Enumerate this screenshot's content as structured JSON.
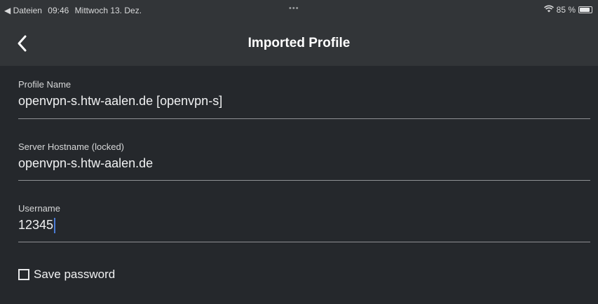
{
  "status_bar": {
    "back_app": "◀ Dateien",
    "time": "09:46",
    "date": "Mittwoch 13. Dez.",
    "dots": "•••",
    "wifi_icon": "wifi-icon",
    "battery_text": "85 %",
    "battery_level": 0.85
  },
  "nav": {
    "back_icon": "chevron-left-icon",
    "title": "Imported Profile"
  },
  "form": {
    "profile_name": {
      "label": "Profile Name",
      "value": "openvpn-s.htw-aalen.de [openvpn-s]"
    },
    "server_hostname": {
      "label": "Server Hostname (locked)",
      "value": "openvpn-s.htw-aalen.de"
    },
    "username": {
      "label": "Username",
      "value": "12345"
    },
    "save_password": {
      "label": "Save password",
      "checked": false
    }
  },
  "colors": {
    "background": "#25282c",
    "bar": "#323538",
    "caret": "#4a7bd6",
    "underline": "#8f9194"
  }
}
